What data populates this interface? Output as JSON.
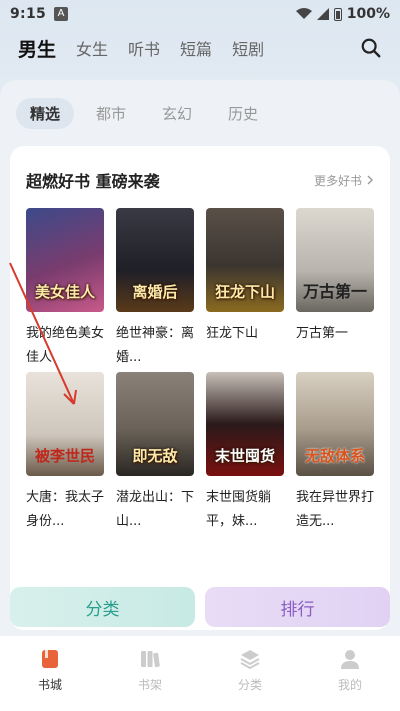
{
  "status_bar": {
    "time": "9:15",
    "battery": "100%"
  },
  "top_nav": {
    "tabs": [
      {
        "label": "男生",
        "active": true
      },
      {
        "label": "女生",
        "active": false
      },
      {
        "label": "听书",
        "active": false
      },
      {
        "label": "短篇",
        "active": false
      },
      {
        "label": "短剧",
        "active": false
      }
    ]
  },
  "sub_tabs": [
    {
      "label": "精选",
      "active": true
    },
    {
      "label": "都市",
      "active": false
    },
    {
      "label": "玄幻",
      "active": false
    },
    {
      "label": "历史",
      "active": false
    }
  ],
  "feature": {
    "title": "超燃好书 重磅来袭",
    "more_label": "更多好书",
    "books": [
      {
        "name": "我的绝色美女佳人",
        "cover_text": "美女佳人",
        "cover_color": "#7a3c6e"
      },
      {
        "name": "绝世神豪：离婚...",
        "cover_text": "离婚后",
        "cover_color": "#1f1f28"
      },
      {
        "name": "狂龙下山",
        "cover_text": "狂龙下山",
        "cover_color": "#3b3530"
      },
      {
        "name": "万古第一",
        "cover_text": "万古第一",
        "cover_color": "#b9b5ae"
      },
      {
        "name": "大唐：我太子身份...",
        "cover_text": "被李世民",
        "cover_color": "#cfc7bd"
      },
      {
        "name": "潜龙出山：下山...",
        "cover_text": "即无敌",
        "cover_color": "#6a6258"
      },
      {
        "name": "末世囤货躺平，妹...",
        "cover_text": "末世囤货",
        "cover_color": "#2a1a1a"
      },
      {
        "name": "我在异世界打造无...",
        "cover_text": "无敌体系",
        "cover_color": "#a89c8c"
      }
    ]
  },
  "quick_buttons": {
    "category": "分类",
    "ranking": "排行"
  },
  "bottom_nav": [
    {
      "label": "书城",
      "icon": "book-city-icon",
      "active": true
    },
    {
      "label": "书架",
      "icon": "bookshelf-icon",
      "active": false
    },
    {
      "label": "分类",
      "icon": "layers-icon",
      "active": false
    },
    {
      "label": "我的",
      "icon": "user-icon",
      "active": false
    }
  ],
  "colors": {
    "accent_orange": "#e8623a",
    "teal": "#2a9d8f",
    "purple": "#8a5cc4"
  }
}
